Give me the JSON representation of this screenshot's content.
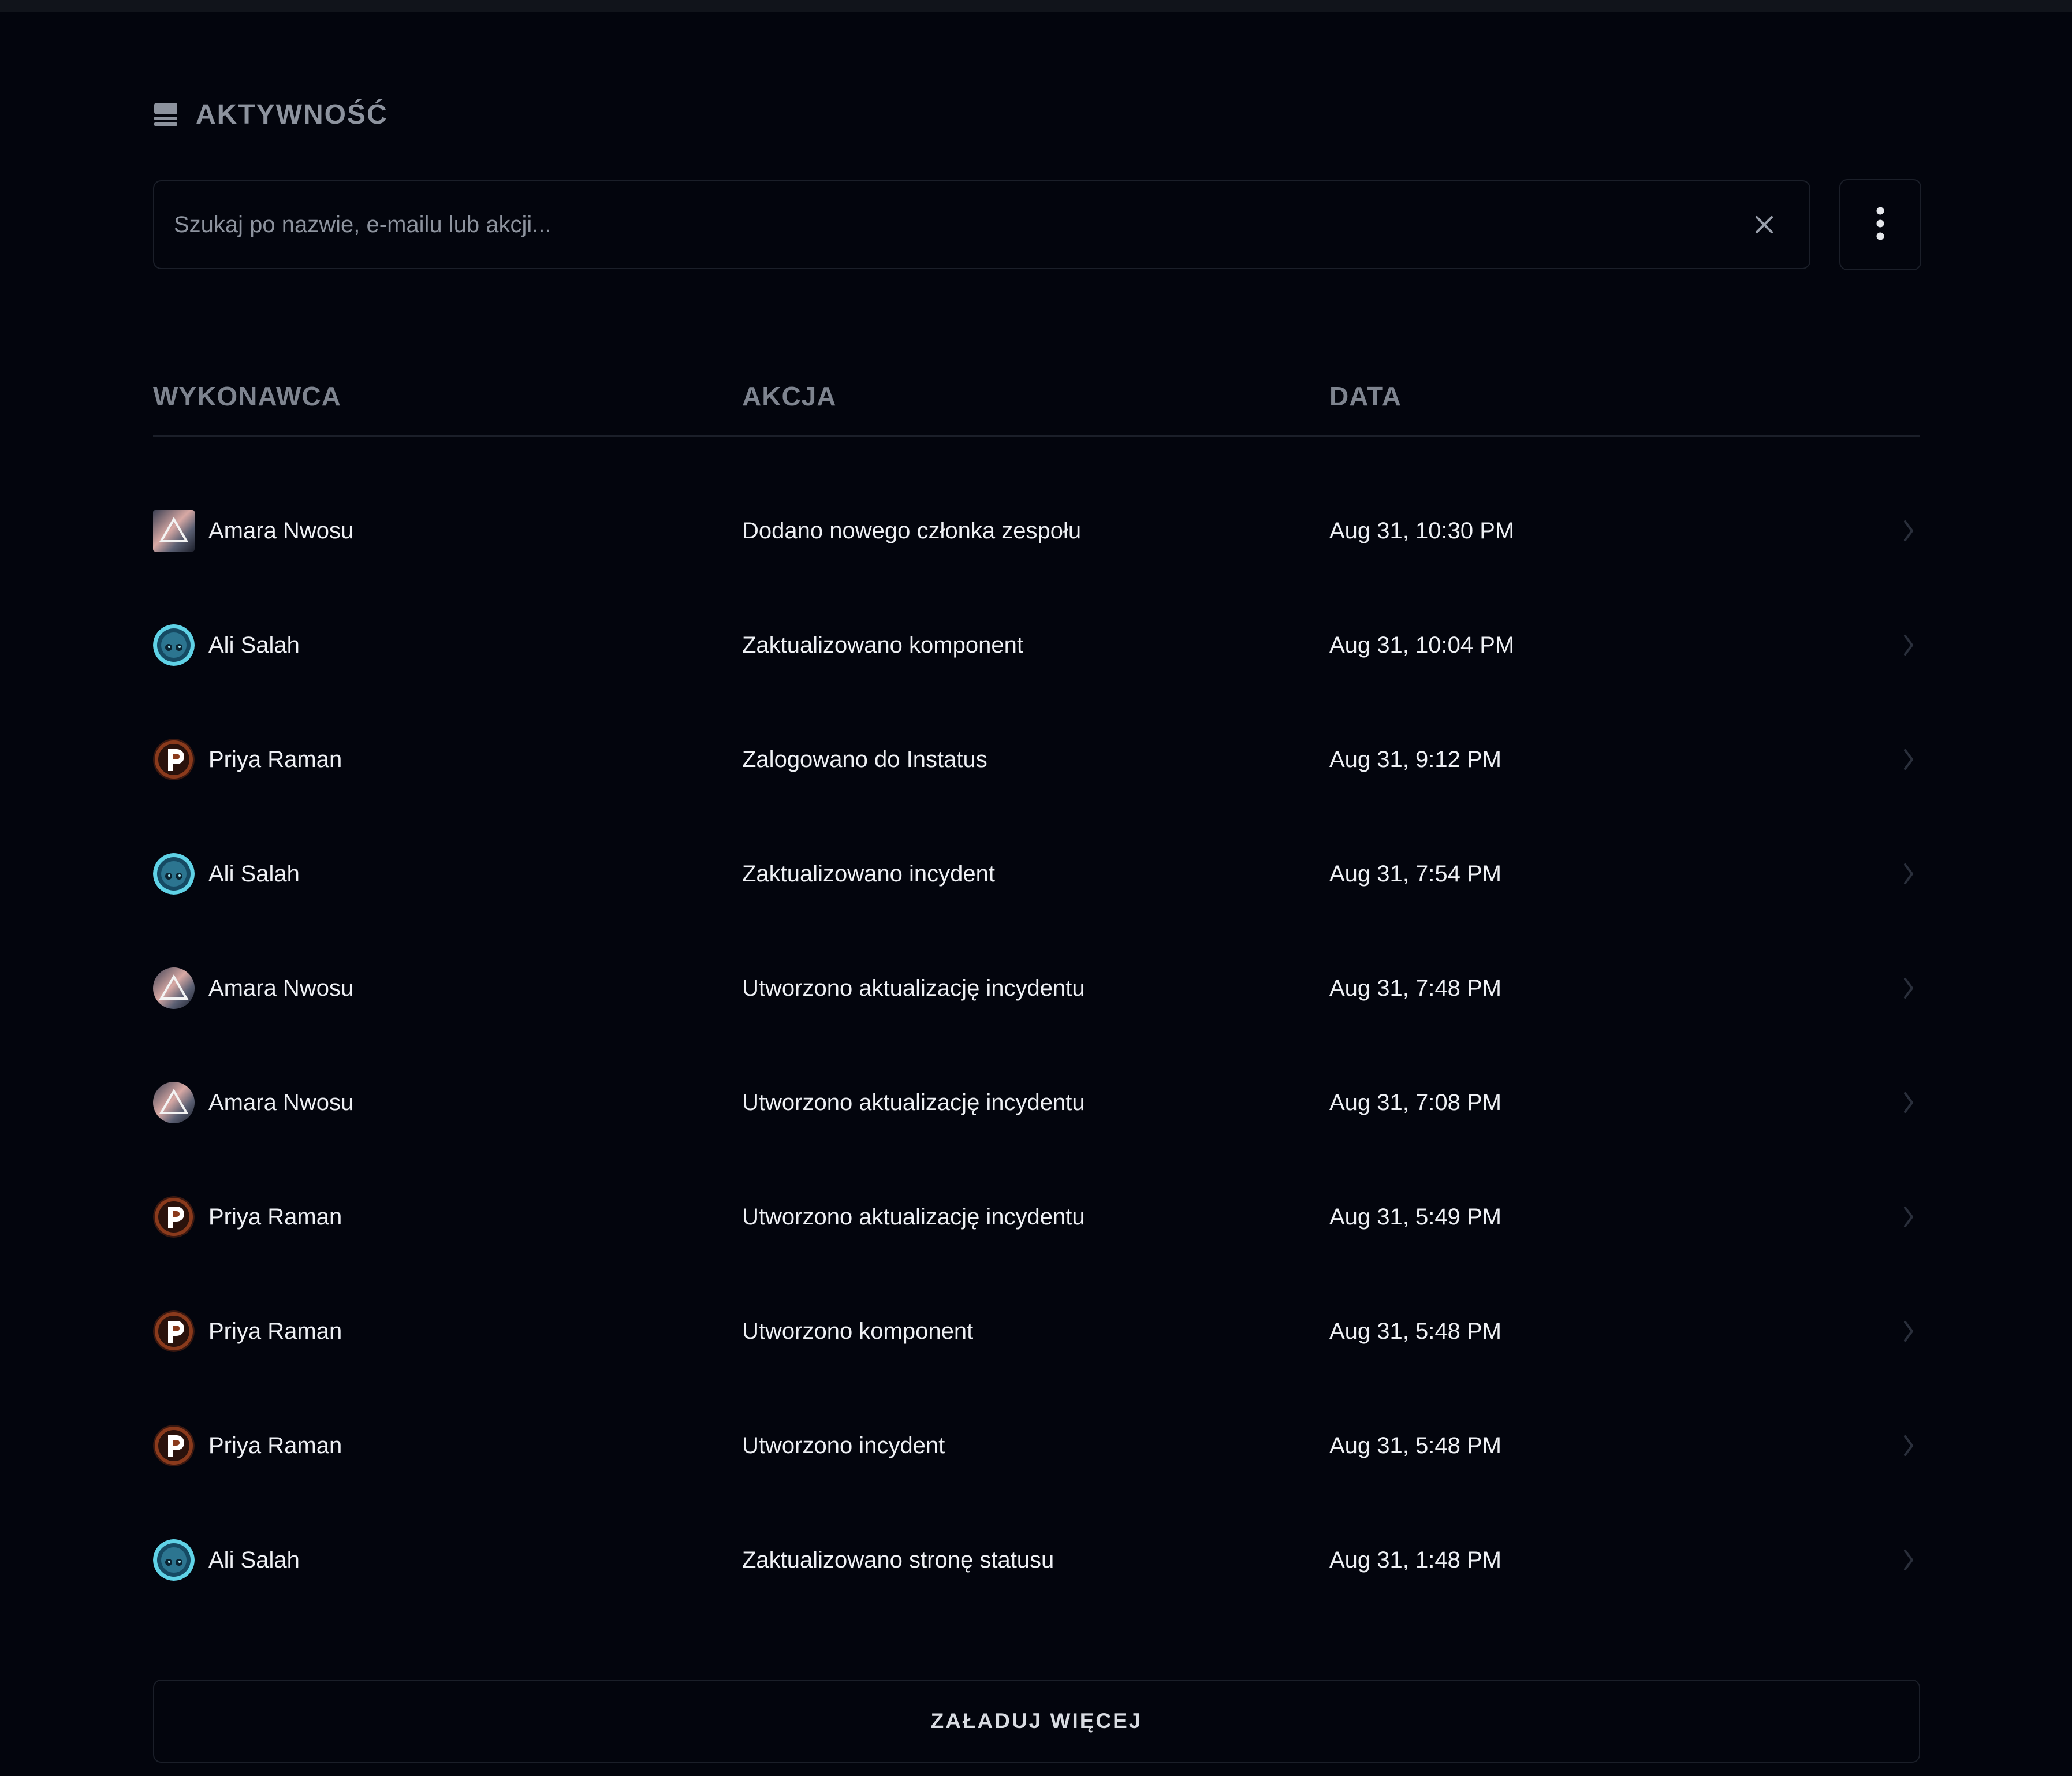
{
  "header": {
    "icon": "list-icon",
    "title": "AKTYWNOŚĆ"
  },
  "search": {
    "placeholder": "Szukaj po nazwie, e-mailu lub akcji...",
    "value": "",
    "clear_icon": "close-icon"
  },
  "more_button": {
    "icon": "more-vertical-icon"
  },
  "table": {
    "headers": [
      "WYKONAWCA",
      "AKCJA",
      "DATA"
    ],
    "rows": [
      {
        "actor": "Amara Nwosu",
        "avatar": "amara",
        "action": "Dodano nowego członka zespołu",
        "date": "Aug 31, 10:30 PM"
      },
      {
        "actor": "Ali Salah",
        "avatar": "ali",
        "action": "Zaktualizowano komponent",
        "date": "Aug 31, 10:04 PM"
      },
      {
        "actor": "Priya Raman",
        "avatar": "priya",
        "action": "Zalogowano do Instatus",
        "date": "Aug 31, 9:12 PM"
      },
      {
        "actor": "Ali Salah",
        "avatar": "ali",
        "action": "Zaktualizowano incydent",
        "date": "Aug 31, 7:54 PM"
      },
      {
        "actor": "Amara Nwosu",
        "avatar": "amara",
        "action": "Utworzono aktualizację incydentu",
        "date": "Aug 31, 7:48 PM"
      },
      {
        "actor": "Amara Nwosu",
        "avatar": "amara",
        "action": "Utworzono aktualizację incydentu",
        "date": "Aug 31, 7:08 PM"
      },
      {
        "actor": "Priya Raman",
        "avatar": "priya",
        "action": "Utworzono aktualizację incydentu",
        "date": "Aug 31, 5:49 PM"
      },
      {
        "actor": "Priya Raman",
        "avatar": "priya",
        "action": "Utworzono komponent",
        "date": "Aug 31, 5:48 PM"
      },
      {
        "actor": "Priya Raman",
        "avatar": "priya",
        "action": "Utworzono incydent",
        "date": "Aug 31, 5:48 PM"
      },
      {
        "actor": "Ali Salah",
        "avatar": "ali",
        "action": "Zaktualizowano stronę statusu",
        "date": "Aug 31, 1:48 PM"
      }
    ]
  },
  "load_more": {
    "label": "ZAŁADUJ WIĘCEJ"
  },
  "colors": {
    "background": "#03050d",
    "border": "#1b1f29",
    "muted_text": "#8d939e",
    "text": "#eef0f4"
  }
}
